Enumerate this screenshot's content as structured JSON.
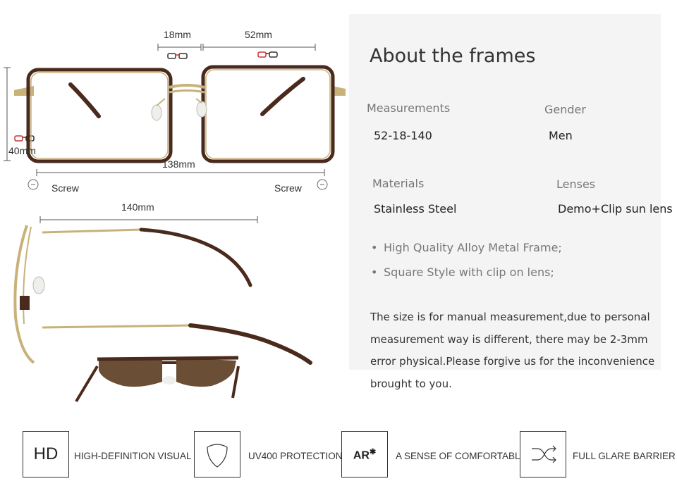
{
  "front_view": {
    "bridge_width": "18mm",
    "lens_width": "52mm",
    "lens_height": "40mm",
    "frame_width": "138mm",
    "screw_left": "Screw",
    "screw_right": "Screw"
  },
  "side_view": {
    "temple_length": "140mm"
  },
  "about": {
    "title": "About the frames",
    "measurements_label": "Measurements",
    "measurements_value": "52-18-140",
    "gender_label": "Gender",
    "gender_value": "Men",
    "materials_label": "Materials",
    "materials_value": "Stainless Steel",
    "lenses_label": "Lenses",
    "lenses_value": "Demo+Clip sun lens",
    "bullets": [
      "High Quality Alloy Metal Frame;",
      "Square Style with clip on lens;"
    ],
    "note_lines": [
      "The size is for manual measurement,due to personal",
      "measurement way is different, there may be 2-3mm",
      "error physical.Please forgive us for the inconvenience",
      "brought to you."
    ]
  },
  "features": [
    {
      "icon_text": "HD",
      "label": "HIGH-DEFINITION VISUAL",
      "icon": "hd-icon"
    },
    {
      "icon_text": "",
      "label": "UV400 PROTECTION",
      "icon": "shield-icon"
    },
    {
      "icon_text": "AR",
      "label": "A SENSE OF COMFORTABLE",
      "icon": "ar-icon"
    },
    {
      "icon_text": "",
      "label": "FULL GLARE BARRIER",
      "icon": "shuffle-arrows-icon"
    }
  ],
  "colors": {
    "frame_brown": "#4a2a1c",
    "frame_gold": "#c8b27a",
    "lens_tint": "#6b4e36",
    "panel_bg": "#f4f4f4",
    "dim_line": "#555555"
  }
}
